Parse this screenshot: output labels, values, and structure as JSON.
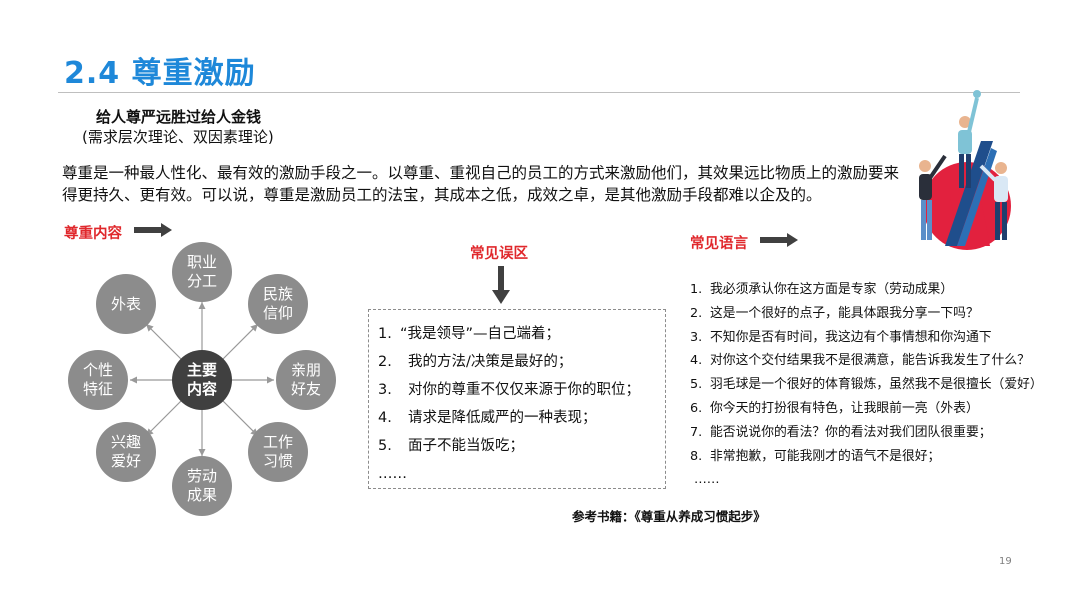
{
  "title": "2.4 尊重激励",
  "subtitle": "给人尊严远胜过给人金钱",
  "subtitle_note": "(需求层次理论、双因素理论)",
  "paragraph": "尊重是一种最人性化、最有效的激励手段之一。以尊重、重视自己的员工的方式来激励他们，其效果远比物质上的激励要来得更持久、更有效。可以说，尊重是激励员工的法宝，其成本之低，成效之卓，是其他激励手段都难以企及的。",
  "content_section": {
    "header": "尊重内容",
    "center": "主要\n内容",
    "nodes": [
      "职业\n分工",
      "民族\n信仰",
      "亲朋\n好友",
      "工作\n习惯",
      "劳动\n成果",
      "兴趣\n爱好",
      "个性\n特征",
      "外表"
    ]
  },
  "misconceptions": {
    "header": "常见误区",
    "items": [
      {
        "num": "1.",
        "text": "“我是领导”—自己端着；"
      },
      {
        "num": "2.",
        "text": "我的方法/决策是最好的；"
      },
      {
        "num": "3.",
        "text": "对你的尊重不仅仅来源于你的职位；"
      },
      {
        "num": "4.",
        "text": "请求是降低威严的一种表现；"
      },
      {
        "num": "5.",
        "text": "面子不能当饭吃；"
      }
    ],
    "more": "……"
  },
  "phrases": {
    "header": "常见语言",
    "items": [
      {
        "num": "1.",
        "text": "我必须承认你在这方面是专家（劳动成果）"
      },
      {
        "num": "2.",
        "text": "这是一个很好的点子，能具体跟我分享一下吗？"
      },
      {
        "num": "3.",
        "text": "不知你是否有时间，我这边有个事情想和你沟通下"
      },
      {
        "num": "4.",
        "text": "对你这个交付结果我不是很满意，能告诉我发生了什么？"
      },
      {
        "num": "5.",
        "text": "羽毛球是一个很好的体育锻炼，虽然我不是很擅长（爱好）"
      },
      {
        "num": "6.",
        "text": "你今天的打扮很有特色，让我眼前一亮（外表）"
      },
      {
        "num": "7.",
        "text": "能否说说你的看法？你的看法对我们团队很重要；"
      },
      {
        "num": "8.",
        "text": "非常抱歉，可能我刚才的语气不是很好；"
      }
    ],
    "more": "……"
  },
  "reference": "参考书籍：《尊重从养成习惯起步》",
  "page_number": "19",
  "colors": {
    "title": "#1e88d9",
    "accent_red": "#e0282c",
    "circle_gray": "#8c8c8c",
    "circle_dark": "#404040"
  }
}
